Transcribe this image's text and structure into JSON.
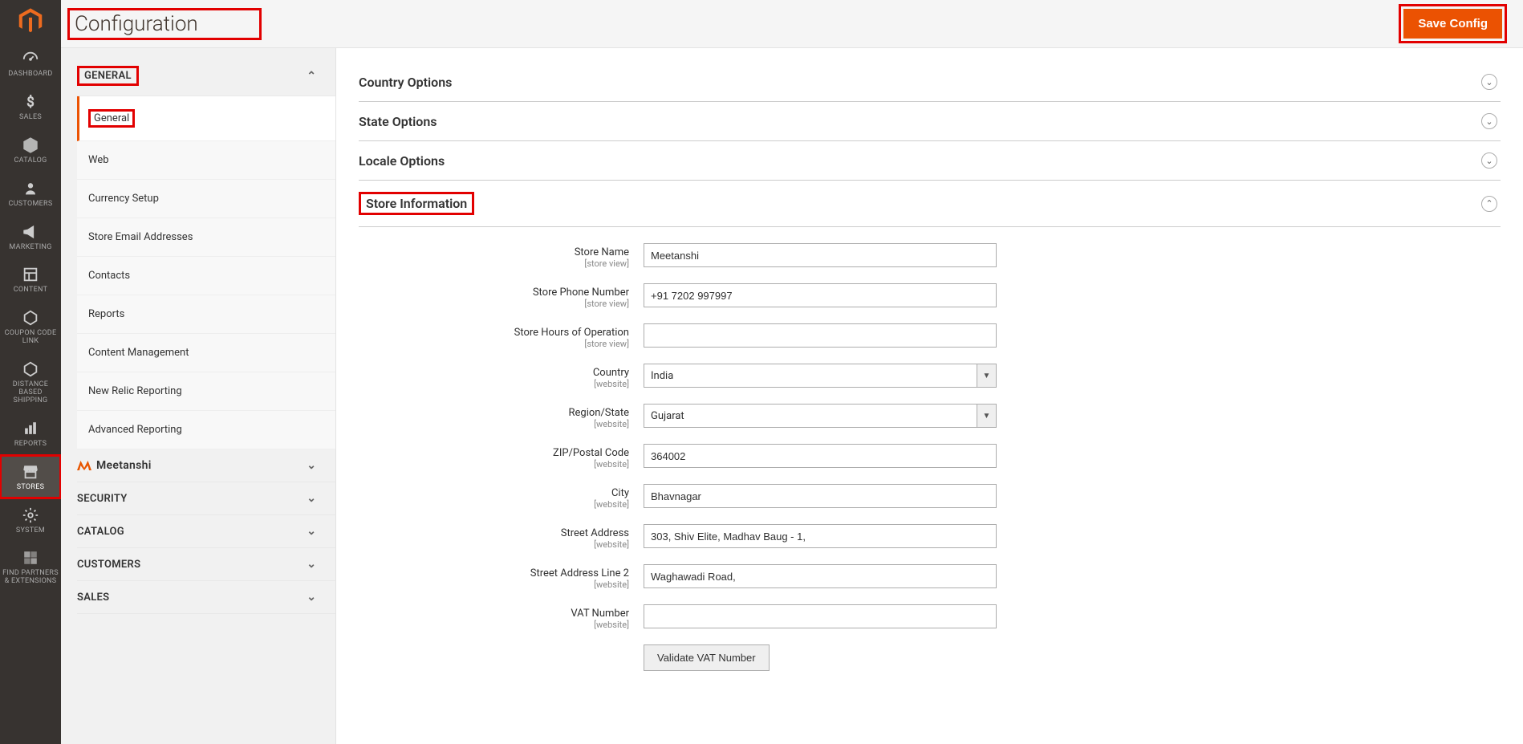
{
  "colors": {
    "accent": "#eb5202",
    "highlight": "#e20000"
  },
  "page": {
    "title": "Configuration",
    "save_label": "Save Config"
  },
  "adminNav": {
    "items": [
      {
        "id": "dashboard",
        "label": "DASHBOARD"
      },
      {
        "id": "sales",
        "label": "SALES"
      },
      {
        "id": "catalog",
        "label": "CATALOG"
      },
      {
        "id": "customers",
        "label": "CUSTOMERS"
      },
      {
        "id": "marketing",
        "label": "MARKETING"
      },
      {
        "id": "content",
        "label": "CONTENT"
      },
      {
        "id": "coupon",
        "label": "COUPON CODE LINK"
      },
      {
        "id": "distance",
        "label": "DISTANCE BASED SHIPPING"
      },
      {
        "id": "reports",
        "label": "REPORTS"
      },
      {
        "id": "stores",
        "label": "STORES",
        "active": true
      },
      {
        "id": "system",
        "label": "SYSTEM"
      },
      {
        "id": "partners",
        "label": "FIND PARTNERS & EXTENSIONS"
      }
    ]
  },
  "sidebar": {
    "sections": [
      {
        "label": "GENERAL",
        "expanded": true,
        "items": [
          {
            "label": "General",
            "active": true
          },
          {
            "label": "Web"
          },
          {
            "label": "Currency Setup"
          },
          {
            "label": "Store Email Addresses"
          },
          {
            "label": "Contacts"
          },
          {
            "label": "Reports"
          },
          {
            "label": "Content Management"
          },
          {
            "label": "New Relic Reporting"
          },
          {
            "label": "Advanced Reporting"
          }
        ]
      },
      {
        "label": "Meetanshi",
        "expanded": false
      },
      {
        "label": "SECURITY",
        "expanded": false
      },
      {
        "label": "CATALOG",
        "expanded": false
      },
      {
        "label": "CUSTOMERS",
        "expanded": false
      },
      {
        "label": "SALES",
        "expanded": false
      }
    ]
  },
  "groups": {
    "country": {
      "title": "Country Options"
    },
    "state": {
      "title": "State Options"
    },
    "locale": {
      "title": "Locale Options"
    },
    "store": {
      "title": "Store Information"
    }
  },
  "storeInfo": {
    "fields": {
      "store_name": {
        "label": "Store Name",
        "scope": "[store view]",
        "value": "Meetanshi"
      },
      "store_phone": {
        "label": "Store Phone Number",
        "scope": "[store view]",
        "value": "+91 7202 997997"
      },
      "store_hours": {
        "label": "Store Hours of Operation",
        "scope": "[store view]",
        "value": ""
      },
      "country": {
        "label": "Country",
        "scope": "[website]",
        "value": "India"
      },
      "region": {
        "label": "Region/State",
        "scope": "[website]",
        "value": "Gujarat"
      },
      "zip": {
        "label": "ZIP/Postal Code",
        "scope": "[website]",
        "value": "364002"
      },
      "city": {
        "label": "City",
        "scope": "[website]",
        "value": "Bhavnagar"
      },
      "street1": {
        "label": "Street Address",
        "scope": "[website]",
        "value": "303, Shiv Elite, Madhav Baug - 1,"
      },
      "street2": {
        "label": "Street Address Line 2",
        "scope": "[website]",
        "value": "Waghawadi Road,"
      },
      "vat": {
        "label": "VAT Number",
        "scope": "[website]",
        "value": ""
      }
    },
    "validate_label": "Validate VAT Number"
  }
}
